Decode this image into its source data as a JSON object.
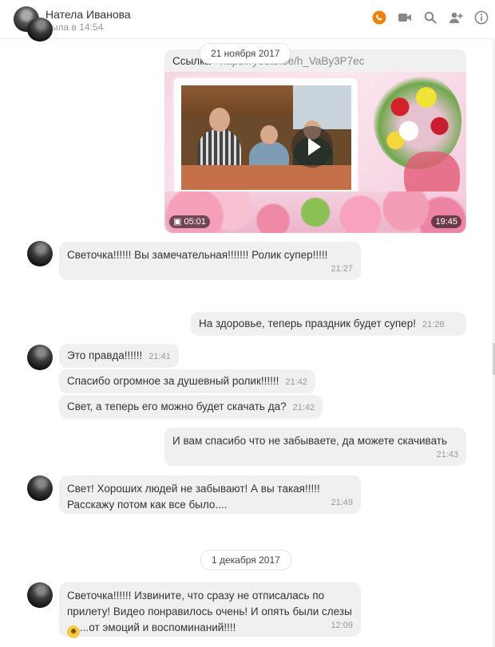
{
  "header": {
    "contact_name": "Натела Иванова",
    "status": "была в 14:54",
    "icons": [
      "phone-icon",
      "video-camera-icon",
      "search-icon",
      "add-user-icon",
      "info-icon"
    ],
    "accent_color": "#ee8208"
  },
  "dates": {
    "nov": "21 ноября 2017",
    "dec": "1 декабря 2017"
  },
  "video": {
    "link_label": "Ссылка -",
    "link_url": "https://youtu.be/h_VaBy3P7ec",
    "duration_left": "05:01",
    "time": "19:45"
  },
  "messages": [
    {
      "text": "Светочка!!!!!! Вы замечательная!!!!!!! Ролик супер!!!!!",
      "time": "21:27"
    },
    {
      "text": "На здоровье, теперь праздник будет супер!",
      "time": "21:28"
    },
    {
      "text": "Это правда!!!!!!",
      "time": "21:41"
    },
    {
      "text": "Спасибо огромное за душевный ролик!!!!!!",
      "time": "21:42"
    },
    {
      "text": "Свет, а теперь его можно будет скачать да?",
      "time": "21:42"
    },
    {
      "text": "И вам спасибо что не забываете, да можете скачивать",
      "time": "21:43"
    },
    {
      "text": "Свет! Хороших людей не забывают! А вы такая!!!!! Расскажу потом как все было....",
      "time": "21:49"
    },
    {
      "text_before": "Светочка!!!!!! Извините, что сразу не отписалась по прилету! Видео понравилось очень! И опять были слезы",
      "emoji": "crying-face-emoji",
      "text_after": "...от эмоций и воспоминаний!!!!",
      "time": "12:09"
    }
  ]
}
